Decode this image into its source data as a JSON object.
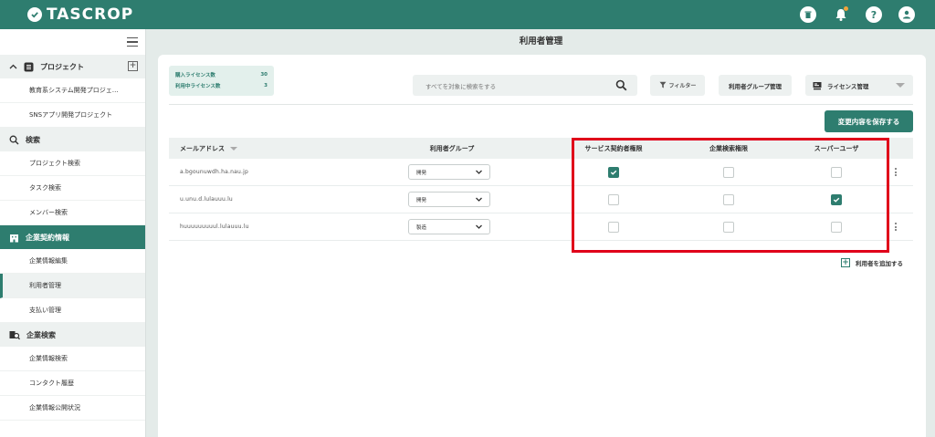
{
  "app": {
    "name": "TASCROP"
  },
  "header": {
    "help_label": "?"
  },
  "sidebar": {
    "project_section": "プロジェクト",
    "add_label": "+",
    "projects": [
      "教育系システム開発プロジェ…",
      "SNSアプリ開発プロジェクト"
    ],
    "search_section": "検索",
    "search_items": [
      "プロジェクト検索",
      "タスク検索",
      "メンバー検索"
    ],
    "contract_section": "企業契約情報",
    "contract_items": [
      "企業情報編集",
      "利用者管理",
      "支払い管理"
    ],
    "company_search_section": "企業検索",
    "company_items": [
      "企業情報検索",
      "コンタクト履歴",
      "企業情報公開状況"
    ]
  },
  "page": {
    "title": "利用者管理"
  },
  "license": {
    "purchased_label": "購入ライセンス数",
    "purchased_value": "30",
    "used_label": "利用中ライセンス数",
    "used_value": "3"
  },
  "toolbar": {
    "search_placeholder": "すべてを対象に検索をする",
    "filter_label": "フィルター",
    "group_button": "利用者グループ管理",
    "license_select": "ライセンス管理",
    "save_button": "変更内容を保存する"
  },
  "table": {
    "headers": {
      "email": "メールアドレス",
      "group": "利用者グループ",
      "service": "サービス契約者権限",
      "enterprise": "企業検索権限",
      "super": "スーパーユーザ"
    },
    "rows": [
      {
        "email": "a.bgounuwdh.ha.nau.jp",
        "group": "開発",
        "service": true,
        "enterprise": false,
        "super": false,
        "menu": true
      },
      {
        "email": "u.unu.d.lulauuu.lu",
        "group": "開発",
        "service": false,
        "enterprise": false,
        "super": true,
        "menu": false
      },
      {
        "email": "huuuuuuuuul.lulauuu.lu",
        "group": "製造",
        "service": false,
        "enterprise": false,
        "super": false,
        "menu": true
      }
    ]
  },
  "add_user_label": "利用者を追加する",
  "colors": {
    "primary": "#2e7d6f",
    "highlight": "#e0001a",
    "accent": "#f2a33a"
  }
}
